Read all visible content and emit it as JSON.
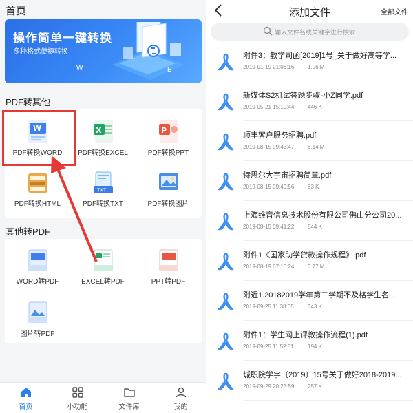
{
  "home": {
    "title": "首页",
    "banner": {
      "title": "操作简单一键转换",
      "subtitle": "多种格式便捷转换",
      "letter_w": "W",
      "letter_e": "E"
    },
    "section_pdf_to_other": "PDF转其他",
    "pdf_tools": [
      {
        "label": "PDF转换WORD",
        "icon": "word-doc-icon"
      },
      {
        "label": "PDF转换EXCEL",
        "icon": "excel-doc-icon"
      },
      {
        "label": "PDF转换PPT",
        "icon": "ppt-doc-icon"
      },
      {
        "label": "PDF转换HTML",
        "icon": "html-doc-icon"
      },
      {
        "label": "PDF转换TXT",
        "icon": "txt-doc-icon"
      },
      {
        "label": "PDF转换图片",
        "icon": "image-doc-icon"
      }
    ],
    "section_other_to_pdf": "其他转PDF",
    "other_tools": [
      {
        "label": "WORD转PDF",
        "icon": "word-to-pdf-icon"
      },
      {
        "label": "EXCEL转PDF",
        "icon": "excel-to-pdf-icon"
      },
      {
        "label": "PPT转PDF",
        "icon": "ppt-to-pdf-icon"
      },
      {
        "label": "图片转PDF",
        "icon": "image-to-pdf-icon"
      }
    ],
    "tabs": [
      {
        "label": "首页",
        "icon": "home-icon",
        "active": true
      },
      {
        "label": "小功能",
        "icon": "grid-icon",
        "active": false
      },
      {
        "label": "文件库",
        "icon": "folder-icon",
        "active": false
      },
      {
        "label": "我的",
        "icon": "user-icon",
        "active": false
      }
    ]
  },
  "add_file": {
    "title": "添加文件",
    "all_files": "全部文件",
    "search_placeholder": "输入文件名或关键字进行搜索",
    "files": [
      {
        "name": "附件3：教学司函[2019]1号_关于做好高等学...",
        "date": "2019-01-19 21:06:16",
        "size": "1.06 M"
      },
      {
        "name": "新媒体S2机试答题步骤-小Z同学.pdf",
        "date": "2019-05-21 15:19:44",
        "size": "446 K"
      },
      {
        "name": "顺丰客户服务招聘.pdf",
        "date": "2019-08-15 09:43:47",
        "size": "6.14 M"
      },
      {
        "name": "特思尔大宇宙招聘简章.pdf",
        "date": "2019-08-15 09:49:56",
        "size": "83 K"
      },
      {
        "name": "上海维音信息技术股份有限公司佛山分公司20...",
        "date": "2019-08-15 09:41:22",
        "size": "544 K"
      },
      {
        "name": "附件1《国家助学贷款操作规程》.pdf",
        "date": "2019-08-19 07:16:24",
        "size": "3.77 M"
      },
      {
        "name": "附近1.20182019学年第二学期不及格学生名...",
        "date": "2019-09-25 11:38:05",
        "size": "343 K"
      },
      {
        "name": "附件1：学生网上评教操作流程(1).pdf",
        "date": "2019-09-25 11:52:51",
        "size": "194 K"
      },
      {
        "name": "城职院学字〔2019〕15号关于做好2018-2019...",
        "date": "2019-09-29 20:25:59",
        "size": "257 K"
      }
    ]
  },
  "colors": {
    "accent": "#2a7ef0",
    "highlight": "#e53935",
    "pdf_icon": "#3f8ff2"
  }
}
